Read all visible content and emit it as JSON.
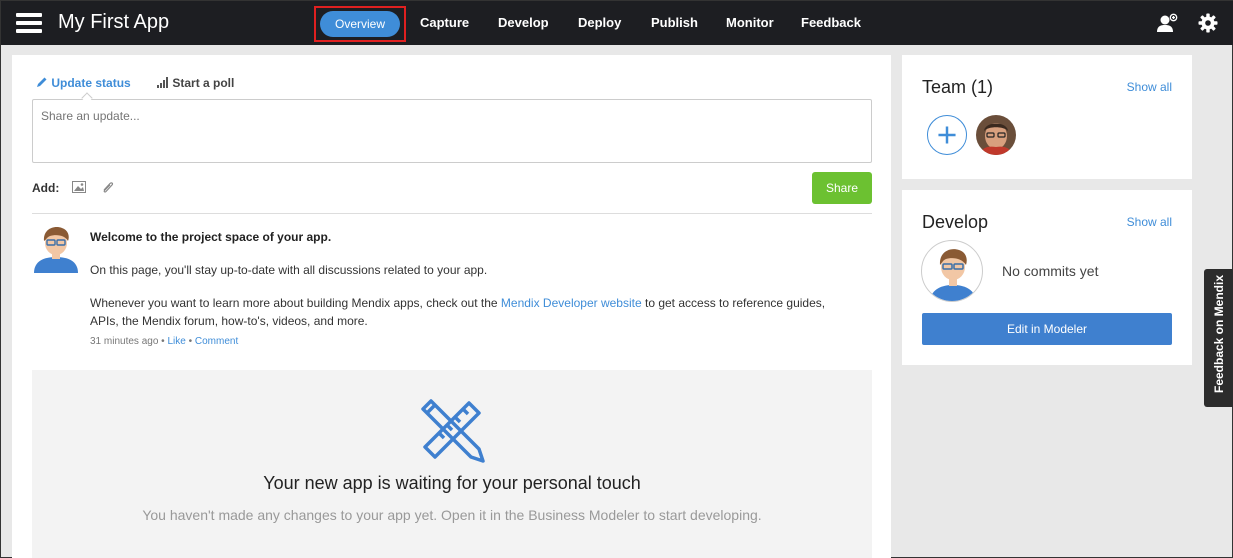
{
  "app": {
    "title": "My First App"
  },
  "nav": {
    "items": [
      {
        "label": "Overview",
        "active": true
      },
      {
        "label": "Capture"
      },
      {
        "label": "Develop"
      },
      {
        "label": "Deploy"
      },
      {
        "label": "Publish"
      },
      {
        "label": "Monitor"
      },
      {
        "label": "Feedback"
      }
    ]
  },
  "topbar_icons": [
    "add-user-icon",
    "gear-icon"
  ],
  "composer": {
    "tabs": [
      "Update status",
      "Start a poll"
    ],
    "placeholder": "Share an update...",
    "add_label": "Add:",
    "share_label": "Share"
  },
  "post": {
    "title": "Welcome to the project space of your app.",
    "line1": "On this page, you'll stay up-to-date with all discussions related to your app.",
    "line2_before": "Whenever you want to learn more about building Mendix apps, check out the ",
    "line2_link": "Mendix Developer website",
    "line2_after": " to get access to reference guides,",
    "line3": "APIs, the Mendix forum, how-to's, videos, and more.",
    "meta_time": "31 minutes ago",
    "meta_sep": " • ",
    "like": "Like",
    "comment": "Comment"
  },
  "empty_state": {
    "title": "Your new app is waiting for your personal touch",
    "subtitle": "You haven't made any changes to your app yet. Open it in the Business Modeler to start developing."
  },
  "team": {
    "title": "Team (1)",
    "show_all": "Show all"
  },
  "develop": {
    "title": "Develop",
    "show_all": "Show all",
    "no_commits": "No commits yet",
    "edit_label": "Edit in Modeler"
  },
  "feedback_tab": {
    "label": "Feedback on Mendix"
  },
  "colors": {
    "accent": "#3f8dd8",
    "share_green": "#6cc131",
    "topbar": "#1d1e22"
  }
}
